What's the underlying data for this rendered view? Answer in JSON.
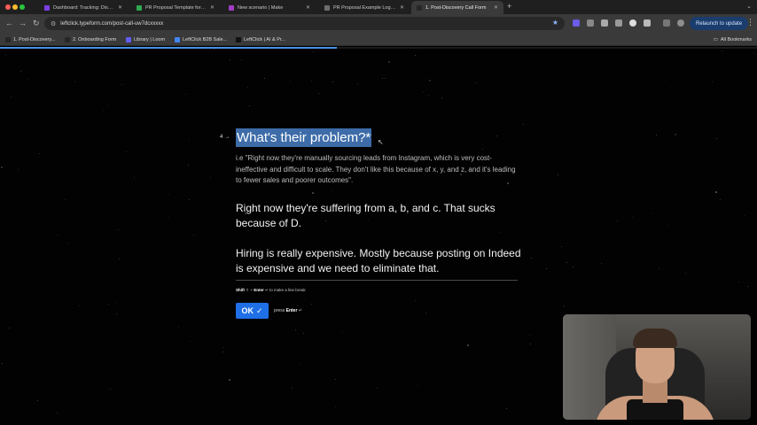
{
  "browser": {
    "tabs": [
      {
        "title": "Dashboard: Tracking: Discov...",
        "favicon_color": "#7b3fe4",
        "active": false
      },
      {
        "title": "PR Proposal Template for st...",
        "favicon_color": "#2fa84f",
        "active": false
      },
      {
        "title": "New scenario | Make",
        "favicon_color": "#a23cc4",
        "active": false
      },
      {
        "title": "PR Proposal Example Loggi...",
        "favicon_color": "#6d6d6d",
        "active": false
      },
      {
        "title": "1. Post-Discovery Call Form",
        "favicon_color": "#262626",
        "active": true
      }
    ],
    "url": "leftclick.typeform.com/post-call-uw7dcxxxxx",
    "relaunch_label": "Relaunch to update",
    "bookmarks": [
      {
        "label": "1. Post-Discovery...",
        "favicon_color": "#262626"
      },
      {
        "label": "2. Onboarding Form",
        "favicon_color": "#262626"
      },
      {
        "label": "Library | Loom",
        "favicon_color": "#625df5"
      },
      {
        "label": "LeftClick B2B Sale...",
        "favicon_color": "#4285f4"
      },
      {
        "label": "LeftClick | AI & Pr...",
        "favicon_color": "#111111"
      }
    ],
    "all_bookmarks_label": "All Bookmarks"
  },
  "form": {
    "progress": 0.445,
    "question_number": "4",
    "question_title": "What's their problem?*",
    "description": "i.e \"Right now they're manually sourcing leads from Instagram, which is very cost-ineffective and difficult to scale. They don't like this because of x, y, and z, and it's leading to fewer sales and poorer outcomes\".",
    "answer_paragraphs": [
      "Right now they're suffering from a, b, and c. That sucks because of D.",
      "Hiring is really expensive. Mostly because posting on Indeed is expensive and we need to eliminate that."
    ],
    "hint_shift": "Shift",
    "hint_plus": "+",
    "hint_enter": "Enter",
    "hint_text": "to make a line break",
    "ok_label": "OK",
    "press_label": "press",
    "press_key": "Enter"
  },
  "colors": {
    "accent": "#1f6fe6",
    "selection": "#3d6ca8",
    "background": "#020203"
  }
}
